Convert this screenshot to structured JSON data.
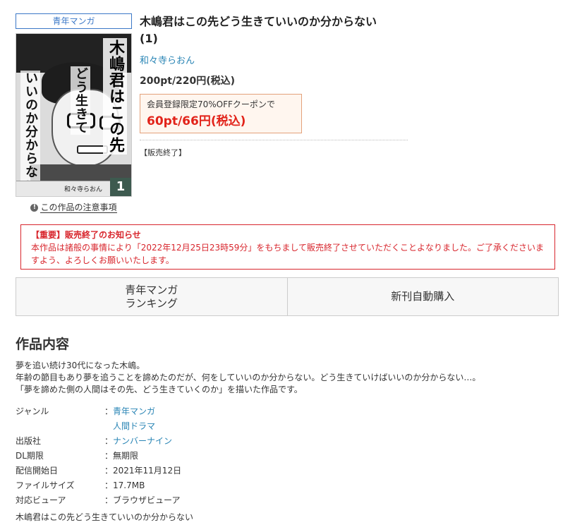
{
  "genre_badge": "青年マンガ",
  "cover": {
    "vertical_title_1": "木嶋君はこの先",
    "vertical_title_2": "どう生きて",
    "vertical_title_3": "いいのか分からない",
    "author": "和々寺らおん",
    "volume": "1"
  },
  "notice_link": "この作品の注意事項",
  "title_line1": "木嶋君はこの先どう生きていいのか分からない",
  "title_line2": "(1)",
  "author": "和々寺らおん",
  "price": "200pt/220円(税込)",
  "coupon": {
    "label": "会員登録限定70%OFFクーポンで",
    "price": "60pt/66円(税込)"
  },
  "status": "【販売終了】",
  "alert": {
    "title": "【重要】販売終了のお知らせ",
    "body": "本作品は諸般の事情により「2022年12月25日23時59分」をもちまして販売終了させていただくことよなりました。ご了承くださいますよう、よろしくお願いいたします。"
  },
  "tabs": {
    "ranking_line1": "青年マンガ",
    "ranking_line2": "ランキング",
    "auto_purchase": "新刊自動購入"
  },
  "section_title": "作品内容",
  "description": {
    "line1": "夢を追い続け30代になった木嶋。",
    "line2": "年齢の節目もあり夢を追うことを諦めたのだが、何をしていいのか分からない。どう生きていけばいいのか分からない…。",
    "line3": "「夢を諦めた側の人間はその先、どう生きていくのか」を描いた作品です。"
  },
  "meta": {
    "genre_key": "ジャンル",
    "genre_values": [
      "青年マンガ",
      "人間ドラマ"
    ],
    "publisher_key": "出版社",
    "publisher_value": "ナンバーナイン",
    "dl_key": "DL期限",
    "dl_value": "無期限",
    "release_key": "配信開始日",
    "release_value": "2021年11月12日",
    "size_key": "ファイルサイズ",
    "size_value": "17.7MB",
    "viewer_key": "対応ビューア",
    "viewer_value": "ブラウザビューア",
    "colon": "："
  },
  "series_title": "木嶋君はこの先どう生きていいのか分からない",
  "colors": {
    "link": "#2a85b5",
    "alert": "#d8262d",
    "coupon_price": "#e2231a",
    "badge_border": "#3b78c7"
  }
}
